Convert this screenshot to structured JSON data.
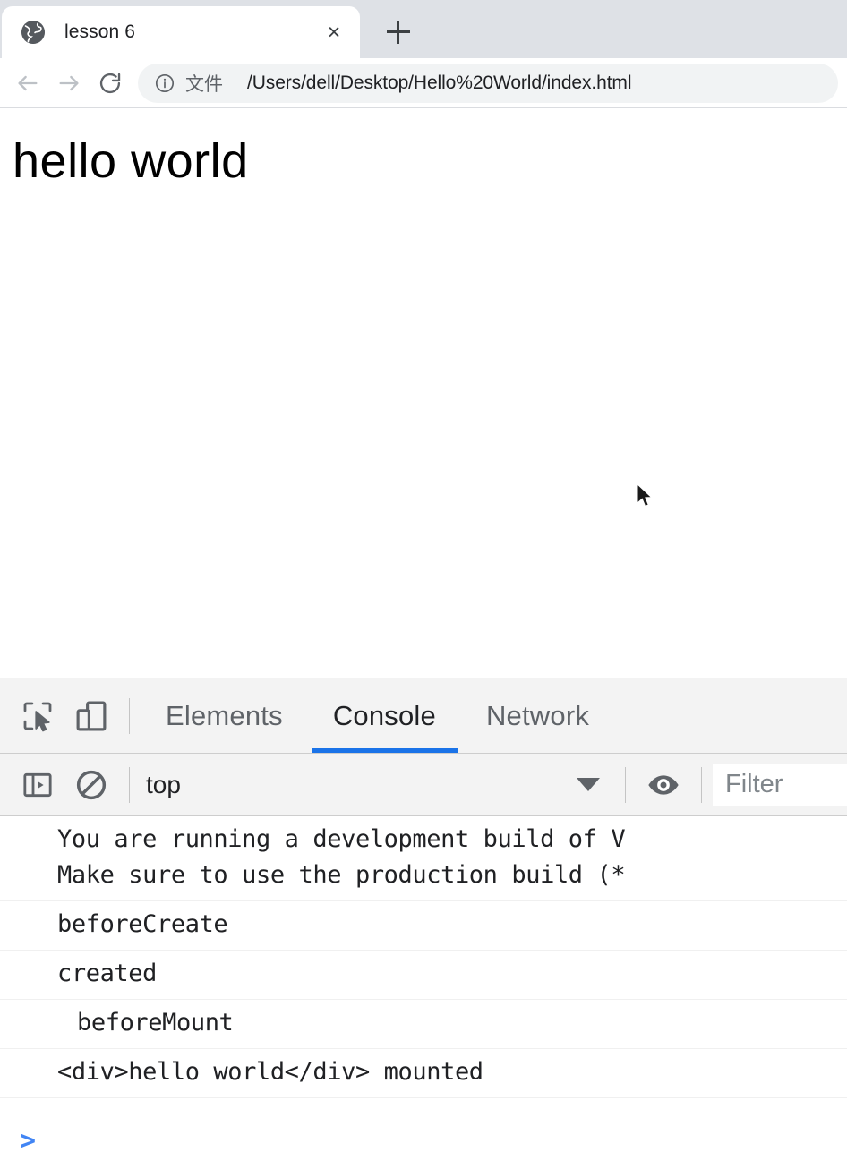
{
  "browser": {
    "tab": {
      "title": "lesson 6",
      "favicon": "globe-icon",
      "close_label": "×"
    },
    "new_tab_label": "+",
    "nav": {
      "back_label": "Back",
      "forward_label": "Forward",
      "reload_label": "Reload"
    },
    "omnibox": {
      "info_icon": "info-circle-icon",
      "scheme_label": "文件",
      "url": "/Users/dell/Desktop/Hello%20World/index.html"
    }
  },
  "page": {
    "heading": "hello world"
  },
  "devtools": {
    "toolbar_icons": {
      "inspect": "inspect-element-icon",
      "device": "device-toolbar-icon"
    },
    "tabs": [
      {
        "label": "Elements",
        "active": false
      },
      {
        "label": "Console",
        "active": true
      },
      {
        "label": "Network",
        "active": false
      }
    ],
    "active_tab": "Console",
    "accent_color": "#1a73e8",
    "console_toolbar": {
      "sidebar_toggle_icon": "console-sidebar-toggle-icon",
      "clear_icon": "clear-console-icon",
      "context_value": "top",
      "context_caret": "chevron-down-icon",
      "live_expression_icon": "eye-icon",
      "filter_placeholder": "Filter"
    },
    "console_messages": [
      {
        "text": "You are running a development build of V",
        "indented": false
      },
      {
        "text": "Make sure to use the production build (*",
        "indented": false
      },
      {
        "text": "beforeCreate",
        "indented": false
      },
      {
        "text": "created",
        "indented": false
      },
      {
        "text": "beforeMount",
        "indented": true
      },
      {
        "text": "<div>hello world</div> mounted",
        "indented": false
      }
    ],
    "prompt_symbol": ">"
  }
}
